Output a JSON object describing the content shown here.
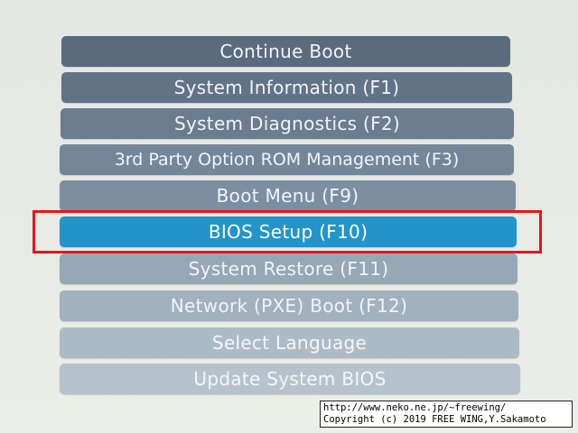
{
  "menu": {
    "items": [
      {
        "label": "Continue Boot",
        "selected": false
      },
      {
        "label": "System Information (F1)",
        "selected": false
      },
      {
        "label": "System Diagnostics (F2)",
        "selected": false
      },
      {
        "label": "3rd Party Option ROM Management (F3)",
        "selected": false
      },
      {
        "label": "Boot Menu (F9)",
        "selected": false
      },
      {
        "label": "BIOS Setup (F10)",
        "selected": true
      },
      {
        "label": "System Restore (F11)",
        "selected": false
      },
      {
        "label": "Network (PXE) Boot (F12)",
        "selected": false
      },
      {
        "label": "Select Language",
        "selected": false
      },
      {
        "label": "Update System BIOS",
        "selected": false
      }
    ]
  },
  "annotation": {
    "highlight_color": "#e8141b",
    "highlighted_item": "BIOS Setup (F10)"
  },
  "watermark": {
    "url": "http://www.neko.ne.jp/~freewing/",
    "copyright": "Copyright (c) 2019 FREE WING,Y.Sakamoto"
  },
  "colors": {
    "selected_item": "#2394c9",
    "item_top": "#5a6b7e",
    "item_bottom": "#b6c3cc",
    "background": "#e7eae4"
  }
}
